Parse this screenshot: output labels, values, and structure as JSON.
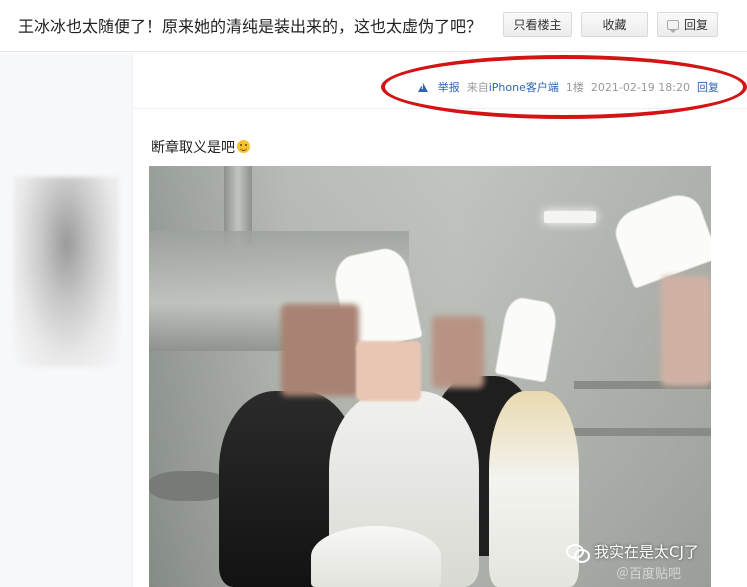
{
  "header": {
    "title": "王冰冰也太随便了！原来她的清纯是装出来的，这也太虚伪了吧？",
    "buttons": {
      "only_owner": "只看楼主",
      "favorite": "收藏",
      "reply": "回复"
    }
  },
  "post": {
    "tail": {
      "report": "举报",
      "source": "来自iPhone客户端",
      "floor": "1楼",
      "time": "2021-02-19 18:20",
      "reply": "回复"
    },
    "text": "断章取义是吧"
  },
  "watermark": {
    "main": "我实在是太CJ了",
    "sub": "＠百度贴吧"
  },
  "colors": {
    "link": "#2d64b3",
    "highlight_ring": "#d21414"
  }
}
